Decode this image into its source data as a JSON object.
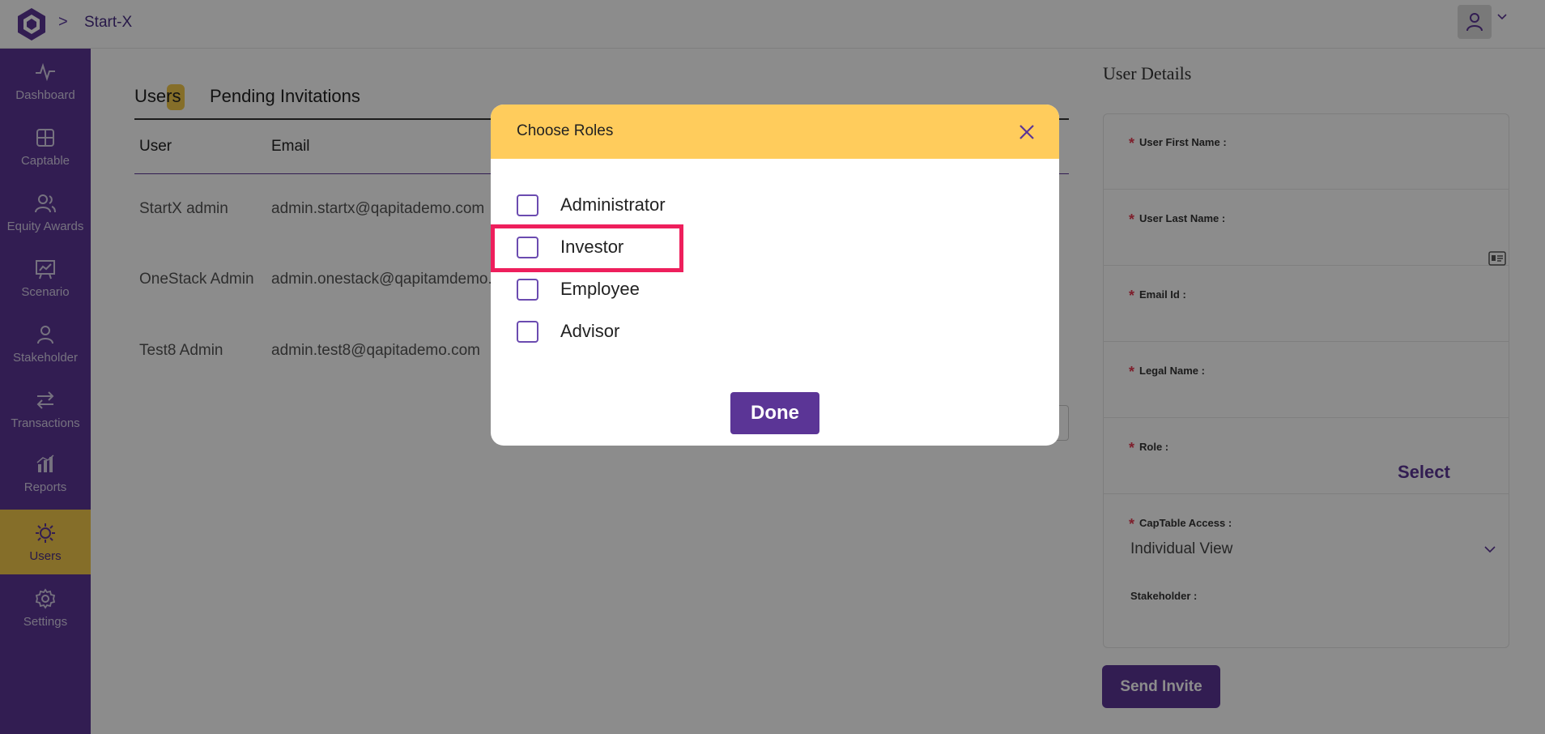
{
  "topbar": {
    "breadcrumb_sep": ">",
    "company": "Start-X"
  },
  "sidebar": {
    "items": [
      {
        "label": "Dashboard",
        "icon": "activity-icon"
      },
      {
        "label": "Captable",
        "icon": "grid-icon"
      },
      {
        "label": "Equity Awards",
        "icon": "users-icon"
      },
      {
        "label": "Scenario",
        "icon": "chart-board-icon"
      },
      {
        "label": "Stakeholder",
        "icon": "user-icon"
      },
      {
        "label": "Transactions",
        "icon": "swap-arrows-icon"
      },
      {
        "label": "Reports",
        "icon": "bar-chart-icon"
      },
      {
        "label": "Users",
        "icon": "gear-users-icon",
        "active": true
      },
      {
        "label": "Settings",
        "icon": "settings-icon"
      }
    ]
  },
  "main": {
    "tabs": [
      {
        "label": "Users"
      },
      {
        "label": "Pending Invitations"
      }
    ],
    "table": {
      "headers": [
        "User",
        "Email"
      ],
      "rows": [
        {
          "user": "StartX admin",
          "email": "admin.startx@qapitademo.com"
        },
        {
          "user": "OneStack Admin",
          "email": "admin.onestack@qapitamdemo.c"
        },
        {
          "user": "Test8 Admin",
          "email": "admin.test8@qapitademo.com"
        }
      ]
    }
  },
  "details": {
    "title": "User Details",
    "fields": {
      "first_name": "User First Name :",
      "last_name": "User Last Name :",
      "email": "Email Id :",
      "legal_name": "Legal Name :",
      "role": "Role :",
      "captable_access": "CapTable Access :",
      "stakeholder": "Stakeholder :"
    },
    "required_mark": "*",
    "role_select": "Select",
    "captable_access_value": "Individual View",
    "send_invite": "Send Invite"
  },
  "modal": {
    "title": "Choose Roles",
    "options": [
      "Administrator",
      "Investor",
      "Employee",
      "Advisor"
    ],
    "done": "Done"
  },
  "colors": {
    "brand": "#5b3596",
    "accent": "#ffcc5c",
    "highlight": "#ee1f5c"
  }
}
